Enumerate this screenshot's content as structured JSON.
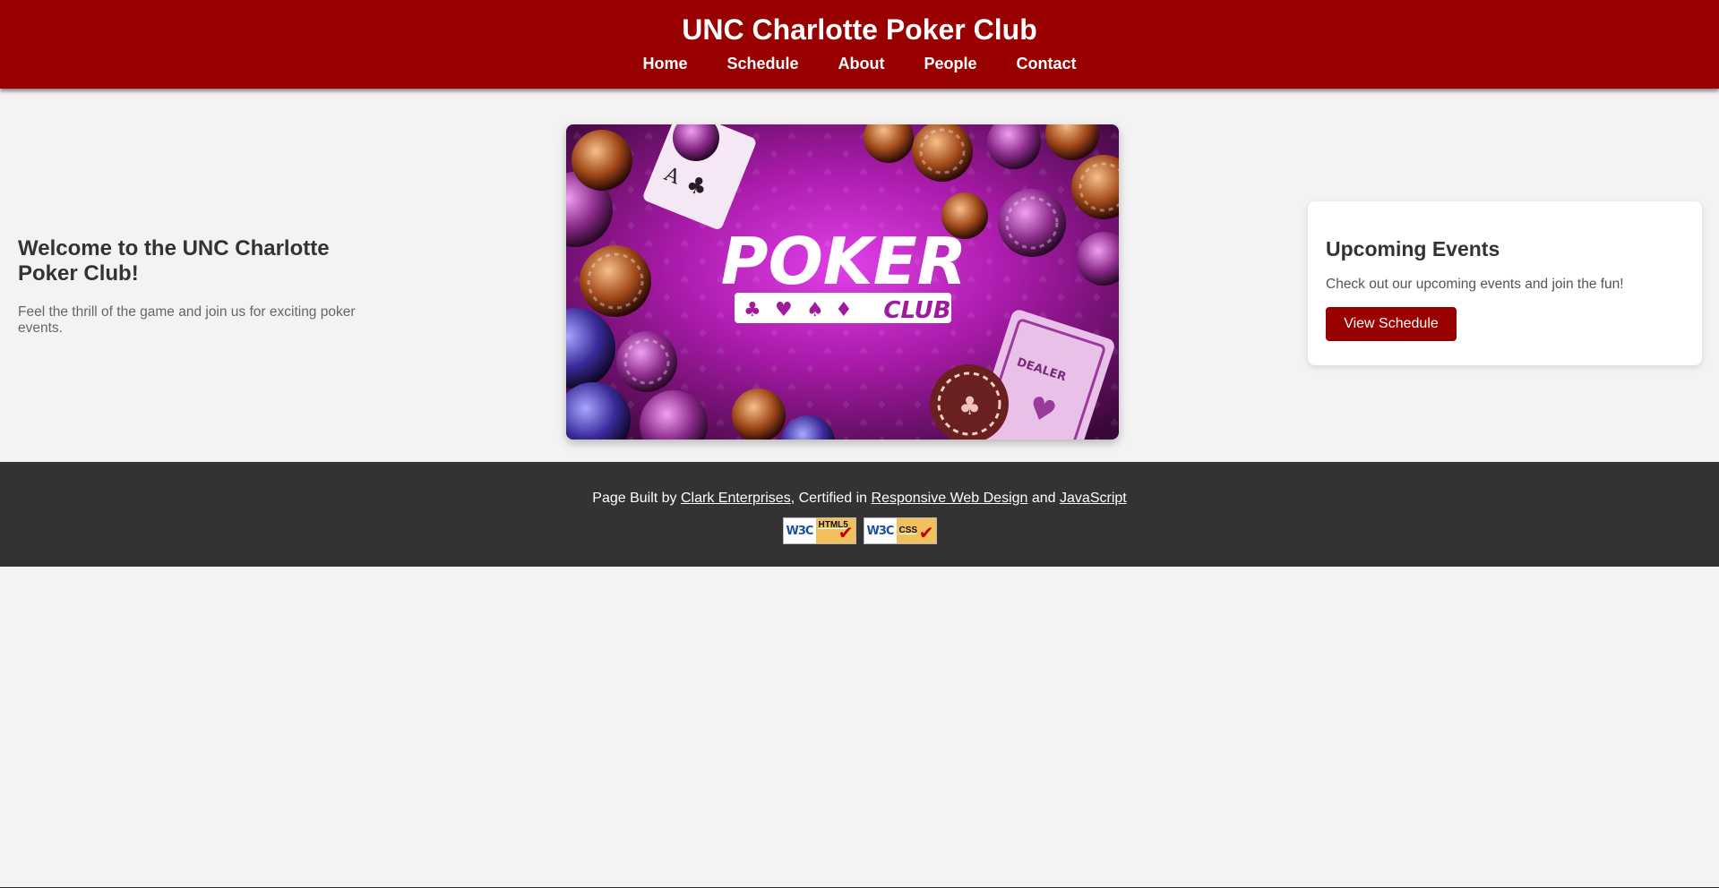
{
  "header": {
    "title": "UNC Charlotte Poker Club",
    "nav": [
      "Home",
      "Schedule",
      "About",
      "People",
      "Contact"
    ],
    "background_color": "#990000"
  },
  "welcome": {
    "heading": "Welcome to the UNC Charlotte Poker Club!",
    "text": "Feel the thrill of the game and join us for exciting poker events."
  },
  "hero": {
    "logo_word": "POKER",
    "logo_sub": "CLUB",
    "card_dealer": "DEALER",
    "card_rank": "A",
    "suits": [
      "♣",
      "♥",
      "♠",
      "♦"
    ]
  },
  "events": {
    "heading": "Upcoming Events",
    "text": "Check out our upcoming events and join the fun!",
    "button_label": "View Schedule"
  },
  "footer": {
    "prefix": "Page Built by ",
    "builder_link": "Clark Enterprises",
    "middle": ", Certified in ",
    "cert1_link": "Responsive Web Design",
    "and": " and ",
    "cert2_link": "JavaScript",
    "badges": [
      {
        "logo": "W3C",
        "label": "HTML5"
      },
      {
        "logo": "W3C",
        "label": "CSS"
      }
    ],
    "background_color": "#333333"
  }
}
